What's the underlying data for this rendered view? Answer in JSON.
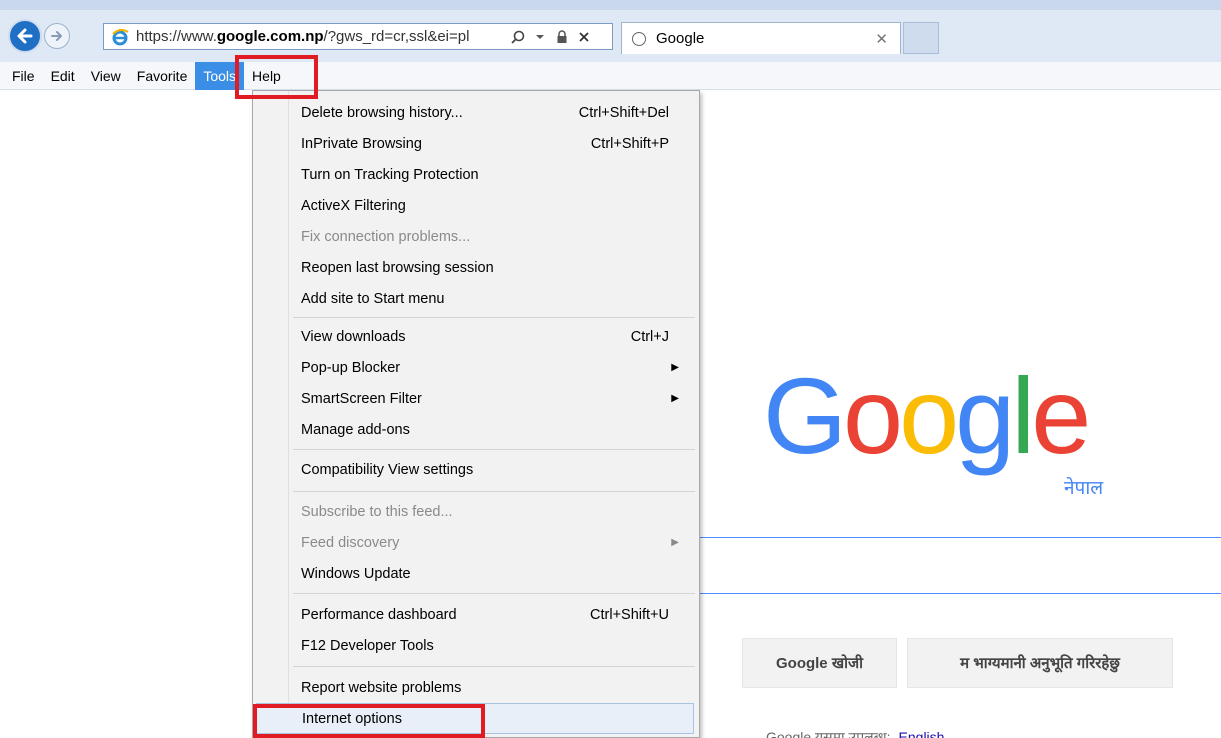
{
  "browser": {
    "url_prefix": "https://www.",
    "url_domain": "google.com.np",
    "url_suffix": "/?gws_rd=cr,ssl&ei=pl",
    "tab_title": "Google"
  },
  "menubar": {
    "items": [
      "File",
      "Edit",
      "View",
      "Favorite",
      "Tools",
      "Help"
    ],
    "active": "Tools"
  },
  "tools_menu": {
    "items": [
      {
        "label": "Delete browsing history...",
        "shortcut": "Ctrl+Shift+Del"
      },
      {
        "label": "InPrivate Browsing",
        "shortcut": "Ctrl+Shift+P"
      },
      {
        "label": "Turn on Tracking Protection"
      },
      {
        "label": "ActiveX Filtering"
      },
      {
        "label": "Fix connection problems...",
        "disabled": true
      },
      {
        "label": "Reopen last browsing session"
      },
      {
        "label": "Add site to Start menu"
      },
      {
        "label": "View downloads",
        "shortcut": "Ctrl+J"
      },
      {
        "label": "Pop-up Blocker",
        "submenu": true
      },
      {
        "label": "SmartScreen Filter",
        "submenu": true
      },
      {
        "label": "Manage add-ons"
      },
      {
        "label": "Compatibility View settings"
      },
      {
        "label": "Subscribe to this feed...",
        "disabled": true
      },
      {
        "label": "Feed discovery",
        "disabled": true,
        "submenu": true
      },
      {
        "label": "Windows Update"
      },
      {
        "label": "Performance dashboard",
        "shortcut": "Ctrl+Shift+U"
      },
      {
        "label": "F12 Developer Tools"
      },
      {
        "label": "Report website problems"
      },
      {
        "label": "Internet options",
        "highlighted": true
      }
    ]
  },
  "google": {
    "logo_letters": [
      "G",
      "o",
      "o",
      "g",
      "l",
      "e"
    ],
    "region": "नेपाल",
    "search_button": "Google खोजी",
    "lucky_button": "म भाग्यमानी अनुभूति गरिरहेछु",
    "offered_in_prefix": "Google",
    "offered_in_text": "यसमा उपलब्ध:",
    "offered_in_lang": "English"
  },
  "colors": {
    "annotation_red": "#e01b24",
    "menu_active": "#3a8ee6",
    "google_blue": "#4285f4",
    "google_red": "#ea4335",
    "google_yellow": "#fbbc05",
    "google_green": "#34a853"
  }
}
